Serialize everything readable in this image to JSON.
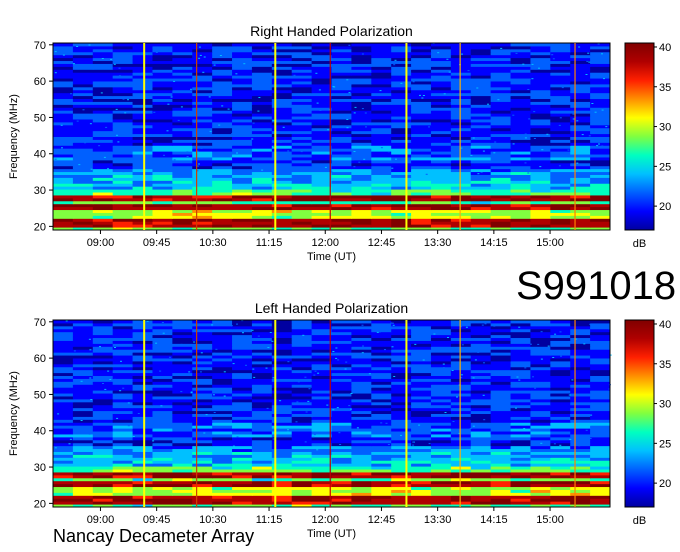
{
  "observation_id": "S991018",
  "instrument": "Nancay Decameter Array",
  "colorscale": {
    "stops": [
      "#0000a0",
      "#0000ff",
      "#0060ff",
      "#00c0ff",
      "#00ffc0",
      "#80ff40",
      "#ffff00",
      "#ff9000",
      "#ff2000",
      "#b00000",
      "#800000"
    ],
    "unit": "dB"
  },
  "chart_data": [
    {
      "type": "heatmap",
      "title": "Right Handed Polarization",
      "xlabel": "Time (UT)",
      "ylabel": "Frequency (MHz)",
      "x_ticks": [
        "09:00",
        "09:45",
        "10:30",
        "11:15",
        "12:00",
        "12:45",
        "13:30",
        "14:15",
        "15:00"
      ],
      "x_range": [
        "08:22",
        "15:48"
      ],
      "y_ticks": [
        20,
        30,
        40,
        50,
        60,
        70
      ],
      "ylim": [
        19,
        70.5
      ],
      "colorbar": {
        "ticks": [
          20,
          25,
          30,
          35,
          40
        ],
        "range": [
          17,
          40.5
        ],
        "label": "dB"
      },
      "bright_bands_mhz": [
        [
          20,
          22
        ],
        [
          24.5,
          26.5
        ],
        [
          27,
          28.5
        ]
      ],
      "vertical_lines": [
        {
          "time": "09:35",
          "color": "#ffff00"
        },
        {
          "time": "10:17",
          "color": "#d04000"
        },
        {
          "time": "11:20",
          "color": "#ffff00"
        },
        {
          "time": "12:04",
          "color": "#c00000"
        },
        {
          "time": "13:05",
          "color": "#ffff00"
        },
        {
          "time": "13:48",
          "color": "#ffb000"
        },
        {
          "time": "15:20",
          "color": "#ff8000"
        }
      ]
    },
    {
      "type": "heatmap",
      "title": "Left Handed Polarization",
      "xlabel": "Time (UT)",
      "ylabel": "Frequency (MHz)",
      "x_ticks": [
        "09:00",
        "09:45",
        "10:30",
        "11:15",
        "12:00",
        "12:45",
        "13:30",
        "14:15",
        "15:00"
      ],
      "x_range": [
        "08:22",
        "15:48"
      ],
      "y_ticks": [
        20,
        30,
        40,
        50,
        60,
        70
      ],
      "ylim": [
        19,
        70.5
      ],
      "colorbar": {
        "ticks": [
          20,
          25,
          30,
          35,
          40
        ],
        "range": [
          17,
          40.5
        ],
        "label": "dB"
      },
      "bright_bands_mhz": [
        [
          20,
          22
        ],
        [
          24.5,
          26.5
        ],
        [
          27,
          28.5
        ]
      ],
      "vertical_lines": [
        {
          "time": "09:35",
          "color": "#ffff00"
        },
        {
          "time": "10:17",
          "color": "#d04000"
        },
        {
          "time": "11:20",
          "color": "#ffff00"
        },
        {
          "time": "12:04",
          "color": "#c00000"
        },
        {
          "time": "13:05",
          "color": "#ffff00"
        },
        {
          "time": "13:48",
          "color": "#ffb000"
        },
        {
          "time": "15:20",
          "color": "#ff8000"
        }
      ]
    }
  ]
}
